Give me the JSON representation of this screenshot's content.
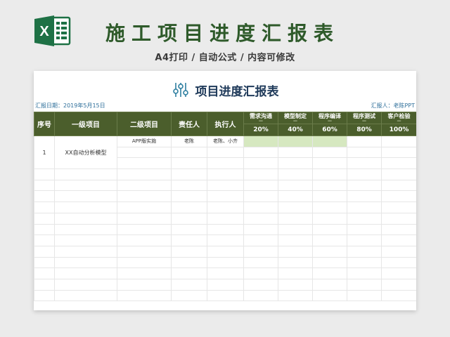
{
  "header": {
    "title": "施工项目进度汇报表",
    "subtitle": "A4打印 / 自动公式 / 内容可修改",
    "logo_icon": "excel-logo-icon",
    "logo_color": "#1e7145"
  },
  "report": {
    "title": "项目进度汇报表",
    "icon": "sliders-icon",
    "date_label": "汇报日期：2019年5月15日",
    "reporter_label": "汇报人：老陈PPT"
  },
  "table": {
    "header_color": "#4b5e2c",
    "progress_fill_color": "#d6e8c0",
    "columns": {
      "seq": "序号",
      "level1": "一级项目",
      "level2": "二级项目",
      "owner": "责任人",
      "executor": "执行人"
    },
    "stages": [
      {
        "name": "需求沟通",
        "dash": "—",
        "pct": "20%"
      },
      {
        "name": "模型制定",
        "dash": "—",
        "pct": "40%"
      },
      {
        "name": "程序编译",
        "dash": "—",
        "pct": "60%"
      },
      {
        "name": "程序测试",
        "dash": "—",
        "pct": "80%"
      },
      {
        "name": "客户检验",
        "dash": "—",
        "pct": "100%"
      }
    ],
    "rows": [
      {
        "seq": "1",
        "level1": "XX自动分析模型",
        "level2": "APP版实施",
        "owner": "老陈",
        "executor": "老陈、小齐",
        "progress": 0.6
      }
    ]
  }
}
